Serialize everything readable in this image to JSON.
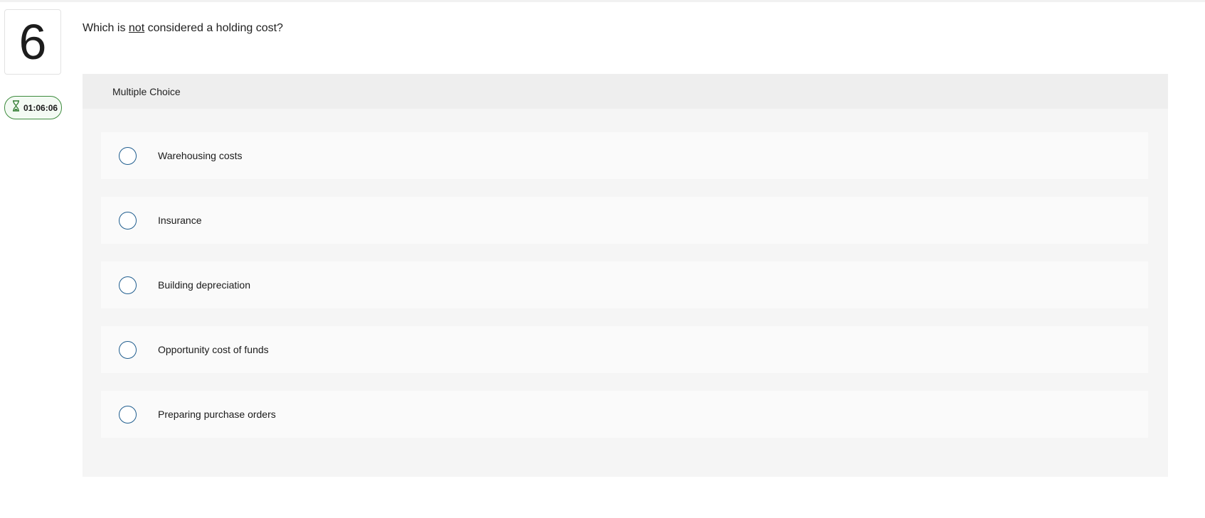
{
  "question": {
    "number": "6",
    "text_before": "Which is ",
    "text_emphasis": "not",
    "text_after": " considered a holding cost?"
  },
  "timer": {
    "value": "01:06:06",
    "icon": "hourglass-icon",
    "color": "#3d8b3d"
  },
  "answer_panel": {
    "type_label": "Multiple Choice",
    "options": [
      {
        "label": "Warehousing costs"
      },
      {
        "label": "Insurance"
      },
      {
        "label": "Building depreciation"
      },
      {
        "label": "Opportunity cost of funds"
      },
      {
        "label": "Preparing purchase orders"
      }
    ]
  },
  "colors": {
    "radio_border": "#1f5d8e",
    "panel_bg": "#f5f5f5",
    "header_bg": "#eeeeee"
  }
}
